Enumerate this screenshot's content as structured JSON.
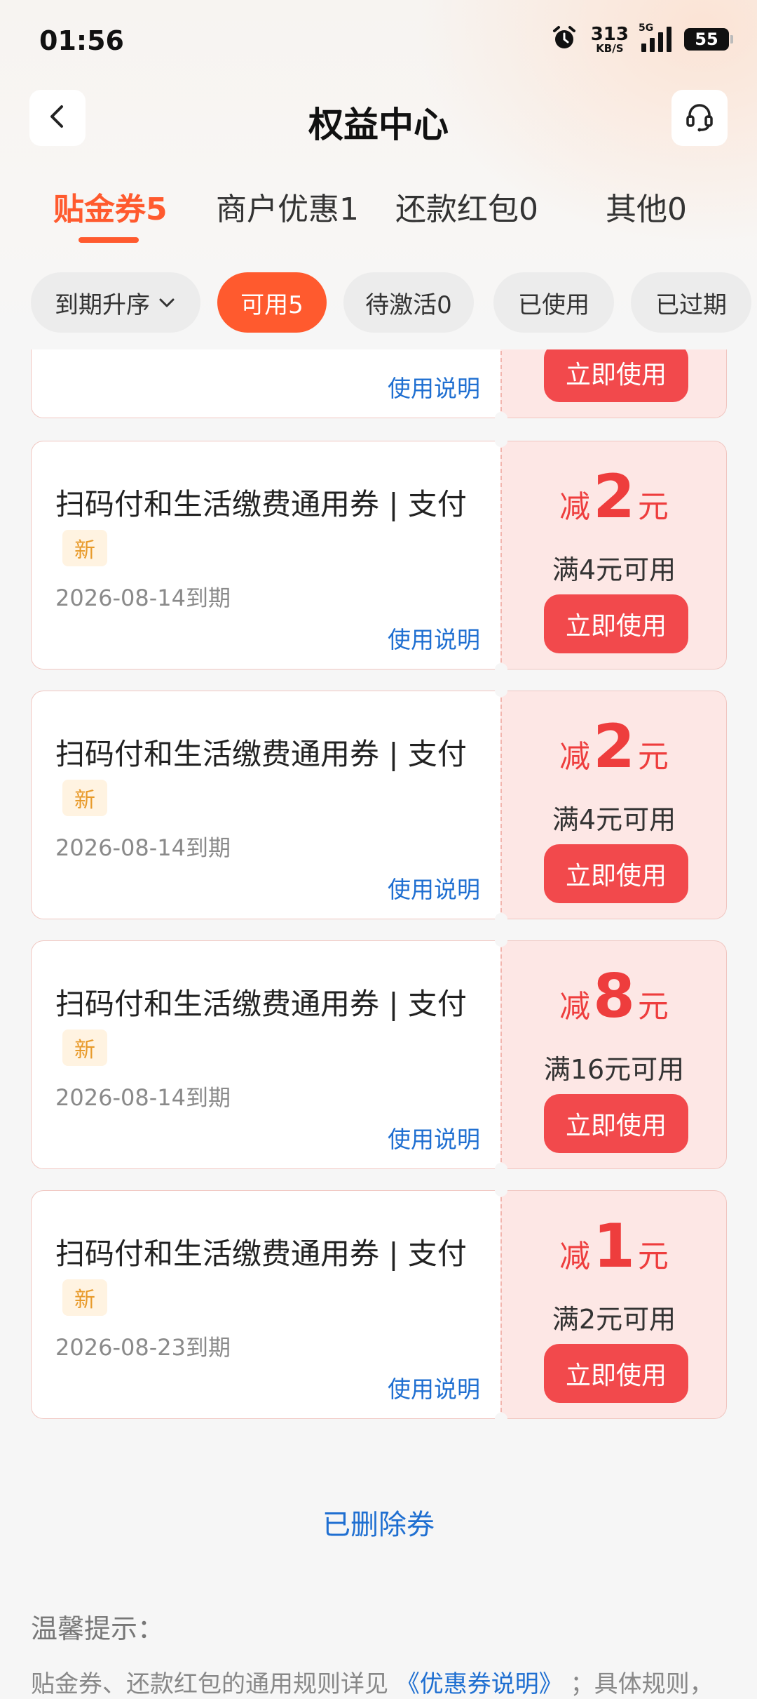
{
  "status_bar": {
    "time": "01:56",
    "net_speed_value": "313",
    "net_speed_unit": "KB/S",
    "network_type": "5G",
    "battery": "55"
  },
  "header": {
    "title": "权益中心"
  },
  "tabs": [
    {
      "label": "贴金券5",
      "active": true
    },
    {
      "label": "商户优惠1",
      "active": false
    },
    {
      "label": "还款红包0",
      "active": false
    },
    {
      "label": "其他0",
      "active": false
    }
  ],
  "filters": {
    "sort": "到期升序",
    "chips": [
      {
        "label": "可用5",
        "active": true
      },
      {
        "label": "待激活0",
        "active": false
      },
      {
        "label": "已使用",
        "active": false
      },
      {
        "label": "已过期",
        "active": false
      }
    ]
  },
  "coupons": [
    {
      "title": "",
      "badge": "",
      "expiry": "",
      "rules_label": "使用说明",
      "amount_prefix": "",
      "amount": "",
      "amount_unit": "",
      "condition": "",
      "action_label": "立即使用"
    },
    {
      "title": "扫码付和生活缴费通用券 | 支付",
      "badge": "新",
      "expiry": "2026-08-14到期",
      "rules_label": "使用说明",
      "amount_prefix": "减",
      "amount": "2",
      "amount_unit": "元",
      "condition": "满4元可用",
      "action_label": "立即使用"
    },
    {
      "title": "扫码付和生活缴费通用券 | 支付",
      "badge": "新",
      "expiry": "2026-08-14到期",
      "rules_label": "使用说明",
      "amount_prefix": "减",
      "amount": "2",
      "amount_unit": "元",
      "condition": "满4元可用",
      "action_label": "立即使用"
    },
    {
      "title": "扫码付和生活缴费通用券 | 支付",
      "badge": "新",
      "expiry": "2026-08-14到期",
      "rules_label": "使用说明",
      "amount_prefix": "减",
      "amount": "8",
      "amount_unit": "元",
      "condition": "满16元可用",
      "action_label": "立即使用"
    },
    {
      "title": "扫码付和生活缴费通用券 | 支付",
      "badge": "新",
      "expiry": "2026-08-23到期",
      "rules_label": "使用说明",
      "amount_prefix": "减",
      "amount": "1",
      "amount_unit": "元",
      "condition": "满2元可用",
      "action_label": "立即使用"
    }
  ],
  "deleted_link": "已删除券",
  "tips": {
    "title": "温馨提示：",
    "text_before": "贴金券、还款红包的通用规则详见",
    "link": "《优惠券说明》",
    "text_after": "；具体规则，"
  },
  "colors": {
    "accent": "#ff5a2e",
    "coupon_red": "#ee3d3d",
    "button_red": "#f2494c",
    "link_blue": "#1f6fd1",
    "coupon_right_bg": "#fde7e5",
    "badge_bg": "#fff3e1"
  },
  "icons": {
    "back": "back-arrow-icon",
    "customer_service": "headset-icon",
    "sort": "chevron-down-icon",
    "alarm": "alarm-icon",
    "signal": "signal-icon",
    "battery": "battery-icon"
  }
}
